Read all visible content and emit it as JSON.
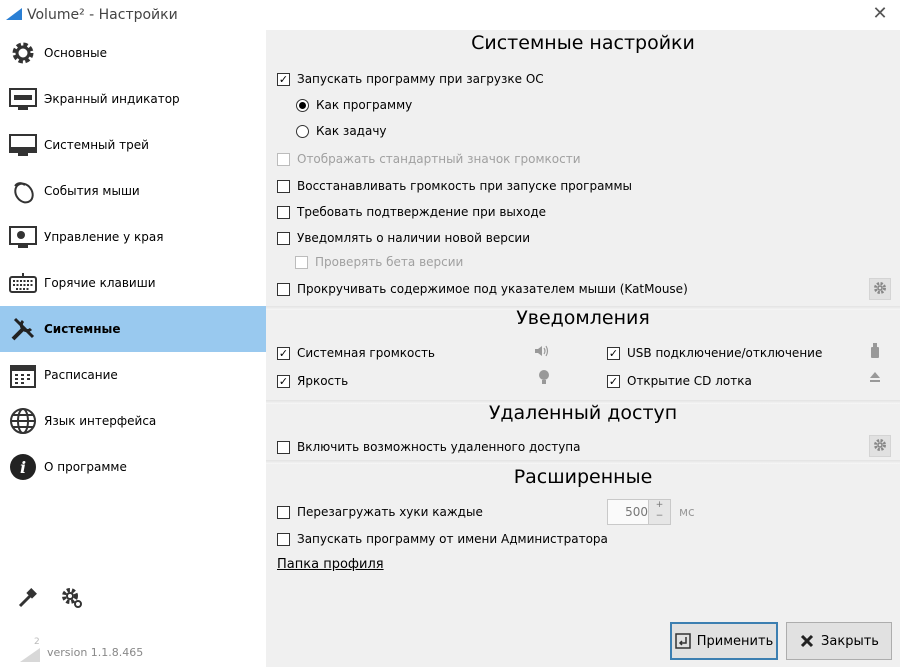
{
  "window": {
    "title": "Volume² - Настройки",
    "close_glyph": "✕"
  },
  "sidebar": {
    "items": [
      {
        "label": "Основные",
        "icon": "gear-icon"
      },
      {
        "label": "Экранный индикатор",
        "icon": "monitor-icon"
      },
      {
        "label": "Системный трей",
        "icon": "tray-icon"
      },
      {
        "label": "События мыши",
        "icon": "mouse-icon"
      },
      {
        "label": "Управление у края",
        "icon": "screen-edge-icon"
      },
      {
        "label": "Горячие клавиши",
        "icon": "keyboard-icon"
      },
      {
        "label": "Системные",
        "icon": "tools-icon",
        "active": true
      },
      {
        "label": "Расписание",
        "icon": "calendar-icon"
      },
      {
        "label": "Язык интерфейса",
        "icon": "globe-icon"
      },
      {
        "label": "О программе",
        "icon": "info-icon"
      }
    ],
    "tools": [
      "brush-icon",
      "settings-gear-icon"
    ],
    "version": "version 1.1.8.465"
  },
  "system": {
    "title": "Системные настройки",
    "launch_at_startup": {
      "label": "Запускать программу при загрузке ОС",
      "checked": true
    },
    "as_program": {
      "label": "Как программу",
      "selected": true
    },
    "as_task": {
      "label": "Как задачу",
      "selected": false
    },
    "show_std_icon": {
      "label": "Отображать стандартный значок громкости",
      "checked": false,
      "disabled": true
    },
    "restore_volume": {
      "label": "Восстанавливать громкость при запуске программы",
      "checked": false
    },
    "confirm_exit": {
      "label": "Требовать подтверждение при выходе",
      "checked": false
    },
    "notify_update": {
      "label": "Уведомлять о наличии новой версии",
      "checked": false
    },
    "check_beta": {
      "label": "Проверять бета версии",
      "checked": false,
      "disabled": true
    },
    "katmouse": {
      "label": "Прокручивать содержимое под указателем мыши (KatMouse)",
      "checked": false
    }
  },
  "notifications": {
    "title": "Уведомления",
    "system_volume": {
      "label": "Системная громкость",
      "checked": true,
      "icon": "speaker-icon"
    },
    "brightness": {
      "label": "Яркость",
      "checked": true,
      "icon": "bulb-icon"
    },
    "usb": {
      "label": "USB подключение/отключение",
      "checked": true,
      "icon": "usb-icon"
    },
    "cd_tray": {
      "label": "Открытие CD лотка",
      "checked": true,
      "icon": "eject-icon"
    }
  },
  "remote": {
    "title": "Удаленный доступ",
    "enable": {
      "label": "Включить возможность удаленного доступа",
      "checked": false
    }
  },
  "advanced": {
    "title": "Расширенные",
    "reload_hooks": {
      "label": "Перезагружать хуки каждые",
      "checked": false
    },
    "hooks_interval": "500",
    "hooks_unit": "мс",
    "run_as_admin": {
      "label": "Запускать программу от имени Администратора",
      "checked": false
    },
    "profile_folder": "Папка профиля"
  },
  "buttons": {
    "apply": "Применить",
    "close": "Закрыть"
  },
  "colors": {
    "active_item": "#99c9ef",
    "panel_bg": "#f0f0f0",
    "apply_border": "#3c7fb1"
  }
}
